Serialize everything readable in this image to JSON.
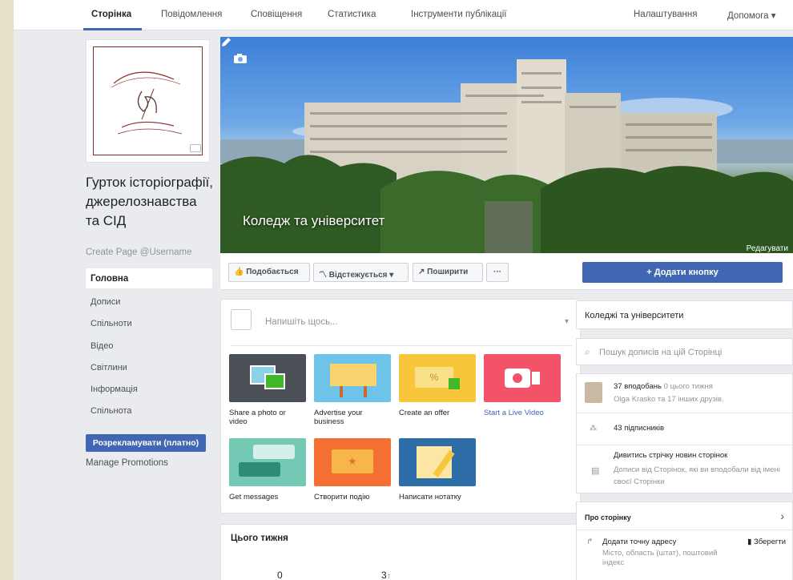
{
  "topnav": {
    "tabs": [
      "Сторінка",
      "Повідомлення",
      "Сповіщення",
      "Статистика",
      "Інструменти публікації"
    ],
    "settings": "Налаштування",
    "help": "Допомога ▾"
  },
  "page": {
    "name": "Гурток історіографії, джерелознавства та СІД",
    "username": "Create Page @Username"
  },
  "leftnav": {
    "active": "Головна",
    "items": [
      "Дописи",
      "Спільноти",
      "Відео",
      "Світлини",
      "Інформація",
      "Спільнота"
    ],
    "promote": "Розрекламувати (платно)",
    "manage": "Manage Promotions"
  },
  "cover": {
    "category": "Коледж та університет",
    "edit": "Редагувати"
  },
  "actions": {
    "like": "Подобається",
    "follow": "Відстежується ▾",
    "share": "Поширити",
    "more": "···",
    "add_button": "+ Додати кнопку"
  },
  "composer": {
    "placeholder": "Напишіть щось...",
    "tiles": [
      {
        "label": "Share a photo or video"
      },
      {
        "label": "Advertise your business"
      },
      {
        "label": "Create an offer"
      },
      {
        "label": "Start a Live Video"
      },
      {
        "label": "Get messages"
      },
      {
        "label": "Створити подію"
      },
      {
        "label": "Написати нотатку"
      }
    ]
  },
  "week": {
    "title": "Цього тижня",
    "stat1": "0",
    "stat2": "3",
    "stat2_arrow": "↑"
  },
  "right": {
    "category": "Коледжі та університети",
    "search_placeholder": "Пошук дописів на цій Сторінці",
    "likes": "37 вподобань",
    "likes_week": "0 цього тижня",
    "friends": "Olga Krasko та 17 інших друзів.",
    "followers": "43 підписників",
    "feed_title": "Дивитись стрічку новин сторінок",
    "feed_desc": "Дописи від Сторінок, які ви вподобали від імені своєї Сторінки",
    "about": "Про сторінку",
    "address": "Додати точну адресу",
    "address_sub": "Місто, область (штат), поштовий індекс",
    "save": "Зберегти"
  },
  "colors": {
    "brand": "#4267b2",
    "background": "#e9ebee",
    "outer": "#e6e0c8"
  }
}
